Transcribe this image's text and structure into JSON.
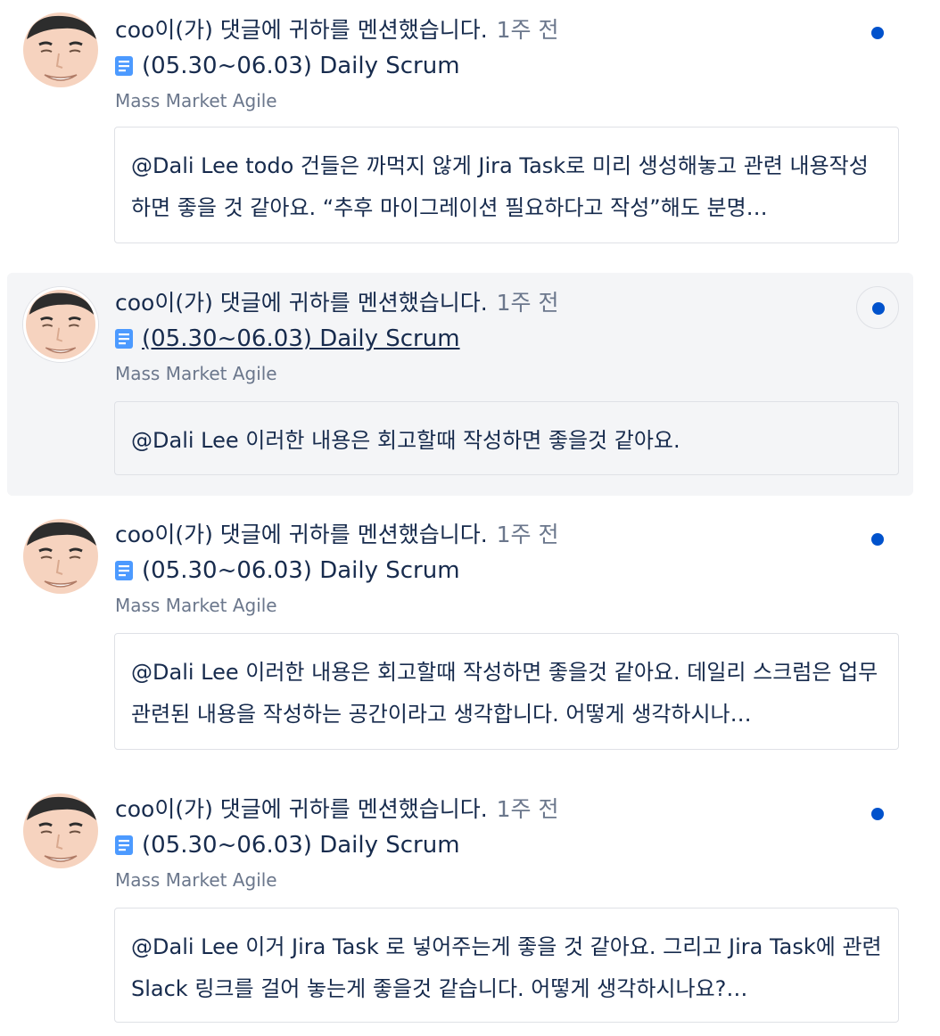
{
  "notifications": [
    {
      "actor": "coo",
      "action": "이(가) 댓글에 귀하를 멘션했습니다.",
      "time": "1주 전",
      "page_title": "(05.30~06.03) Daily Scrum",
      "space": "Mass Market Agile",
      "comment": "@Dali Lee todo 건들은 까먹지 않게 Jira Task로 미리 생성해놓고 관련 내용작성하면 좋을 것 같아요. “추후 마이그레이션 필요하다고 작성”해도 분명…"
    },
    {
      "actor": "coo",
      "action": "이(가) 댓글에 귀하를 멘션했습니다.",
      "time": "1주 전",
      "page_title": "(05.30~06.03) Daily Scrum",
      "space": "Mass Market Agile",
      "comment": "@Dali Lee 이러한 내용은 회고할때 작성하면 좋을것 같아요."
    },
    {
      "actor": "coo",
      "action": "이(가) 댓글에 귀하를 멘션했습니다.",
      "time": "1주 전",
      "page_title": "(05.30~06.03) Daily Scrum",
      "space": "Mass Market Agile",
      "comment": "@Dali Lee 이러한 내용은 회고할때 작성하면 좋을것 같아요. 데일리 스크럼은 업무 관련된 내용을 작성하는 공간이라고 생각합니다. 어떻게 생각하시나…"
    },
    {
      "actor": "coo",
      "action": "이(가) 댓글에 귀하를 멘션했습니다.",
      "time": "1주 전",
      "page_title": "(05.30~06.03) Daily Scrum",
      "space": "Mass Market Agile",
      "comment": "@Dali Lee 이거 Jira Task 로 넣어주는게 좋을 것 같아요. 그리고 Jira Task에 관련 Slack 링크를 걸어 놓는게 좋을것 같습니다. 어떻게 생각하시나요?…"
    }
  ],
  "colors": {
    "unread_dot": "#0052cc",
    "page_icon": "#4c9aff",
    "hover_bg": "#f4f5f7",
    "muted_text": "#6b778c",
    "primary_text": "#172b4d"
  },
  "icons": {
    "avatar": "user-avatar-icon",
    "page": "page-icon",
    "unread": "unread-dot-icon"
  }
}
